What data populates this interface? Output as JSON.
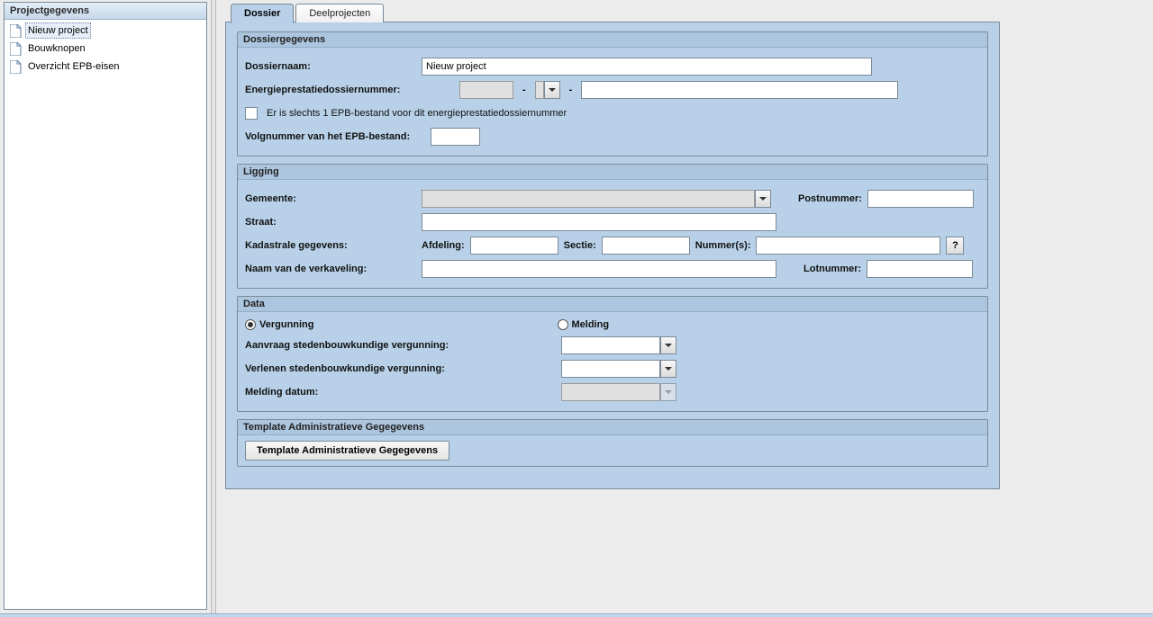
{
  "sidebar": {
    "title": "Projectgegevens",
    "items": [
      {
        "label": "Nieuw project",
        "selected": true
      },
      {
        "label": "Bouwknopen",
        "selected": false
      },
      {
        "label": "Overzicht EPB-eisen",
        "selected": false
      }
    ]
  },
  "tabs": {
    "dossier": "Dossier",
    "deelprojecten": "Deelprojecten"
  },
  "groups": {
    "dossiergegevens": {
      "title": "Dossiergegevens",
      "dossiernaam_label": "Dossiernaam:",
      "dossiernaam_value": "Nieuw project",
      "epd_label": "Energieprestatiedossiernummer:",
      "epd_part1": "",
      "epd_part2": "",
      "epd_part3": "",
      "single_epb_checkbox_label": "Er is slechts 1 EPB-bestand voor dit energieprestatiedossiernummer",
      "single_epb_checked": false,
      "volgnr_label": "Volgnummer van het EPB-bestand:",
      "volgnr_value": ""
    },
    "ligging": {
      "title": "Ligging",
      "gemeente_label": "Gemeente:",
      "gemeente_value": "",
      "postnummer_label": "Postnummer:",
      "postnummer_value": "",
      "straat_label": "Straat:",
      "straat_value": "",
      "kadastrale_label": "Kadastrale gegevens:",
      "afdeling_label": "Afdeling:",
      "afdeling_value": "",
      "sectie_label": "Sectie:",
      "sectie_value": "",
      "nummers_label": "Nummer(s):",
      "nummers_value": "",
      "help_btn": "?",
      "verkaveling_label": "Naam van de verkaveling:",
      "verkaveling_value": "",
      "lotnummer_label": "Lotnummer:",
      "lotnummer_value": ""
    },
    "data": {
      "title": "Data",
      "vergunning_label": "Vergunning",
      "melding_label": "Melding",
      "selected_radio": "vergunning",
      "aanvraag_label": "Aanvraag stedenbouwkundige vergunning:",
      "aanvraag_value": "",
      "verlenen_label": "Verlenen stedenbouwkundige vergunning:",
      "verlenen_value": "",
      "melding_datum_label": "Melding datum:",
      "melding_datum_value": ""
    },
    "template": {
      "title": "Template Administratieve Gegegevens",
      "button_label": "Template Administratieve Gegegevens"
    }
  }
}
